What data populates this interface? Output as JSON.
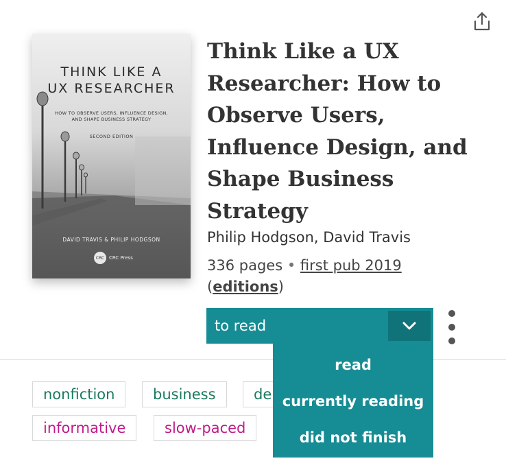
{
  "book": {
    "title": "Think Like a UX Researcher: How to Observe Users, Influence Design, and Shape Business Strategy",
    "authors": "Philip Hodgson, David Travis",
    "pages": "336 pages",
    "first_pub": "first pub 2019",
    "editions_link": "editions"
  },
  "cover": {
    "title_line1": "THINK LIKE A",
    "title_line2": "UX RESEARCHER",
    "subtitle_line1": "HOW TO OBSERVE USERS, INFLUENCE DESIGN,",
    "subtitle_line2": "AND SHAPE BUSINESS STRATEGY",
    "edition": "SECOND EDITION",
    "authors": "DAVID TRAVIS & PHILIP HODGSON",
    "publisher": "CRC Press",
    "publisher_logo": "CRC"
  },
  "status": {
    "current": "to read",
    "menu": [
      "read",
      "currently reading",
      "did not finish"
    ]
  },
  "tags": {
    "row1": [
      "nonfiction",
      "business",
      "de"
    ],
    "row2": [
      "informative",
      "slow-paced"
    ]
  },
  "colors": {
    "accent": "#168c94",
    "accent_dark": "#10737a",
    "tag_green": "#1a7a5e",
    "tag_pink": "#c01b8a"
  },
  "icons": {
    "share": "share-icon",
    "caret": "chevron-down-icon",
    "more": "more-vertical-icon"
  }
}
